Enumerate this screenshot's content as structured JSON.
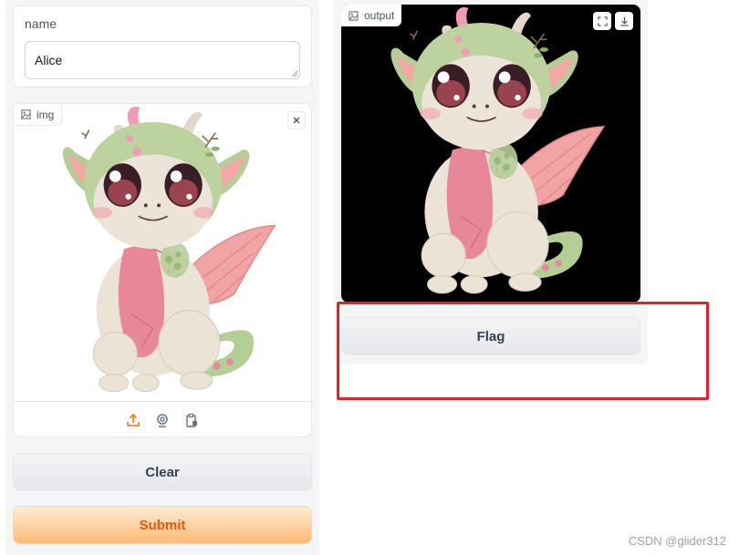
{
  "inputs": {
    "name_label": "name",
    "name_value": "Alice",
    "image_label": "img",
    "image_content": "cartoon-baby-dragon",
    "source_icons": [
      "upload-icon",
      "webcam-icon",
      "clipboard-icon"
    ]
  },
  "buttons": {
    "clear_label": "Clear",
    "submit_label": "Submit",
    "flag_label": "Flag"
  },
  "output": {
    "label": "output",
    "tools": [
      "fullscreen-icon",
      "download-icon"
    ]
  },
  "annotation": {
    "highlight_color": "#ef1c24"
  },
  "watermark": "CSDN @glider312",
  "colors": {
    "submit_text": "#ea580c",
    "accent_orange": "#f97316"
  }
}
